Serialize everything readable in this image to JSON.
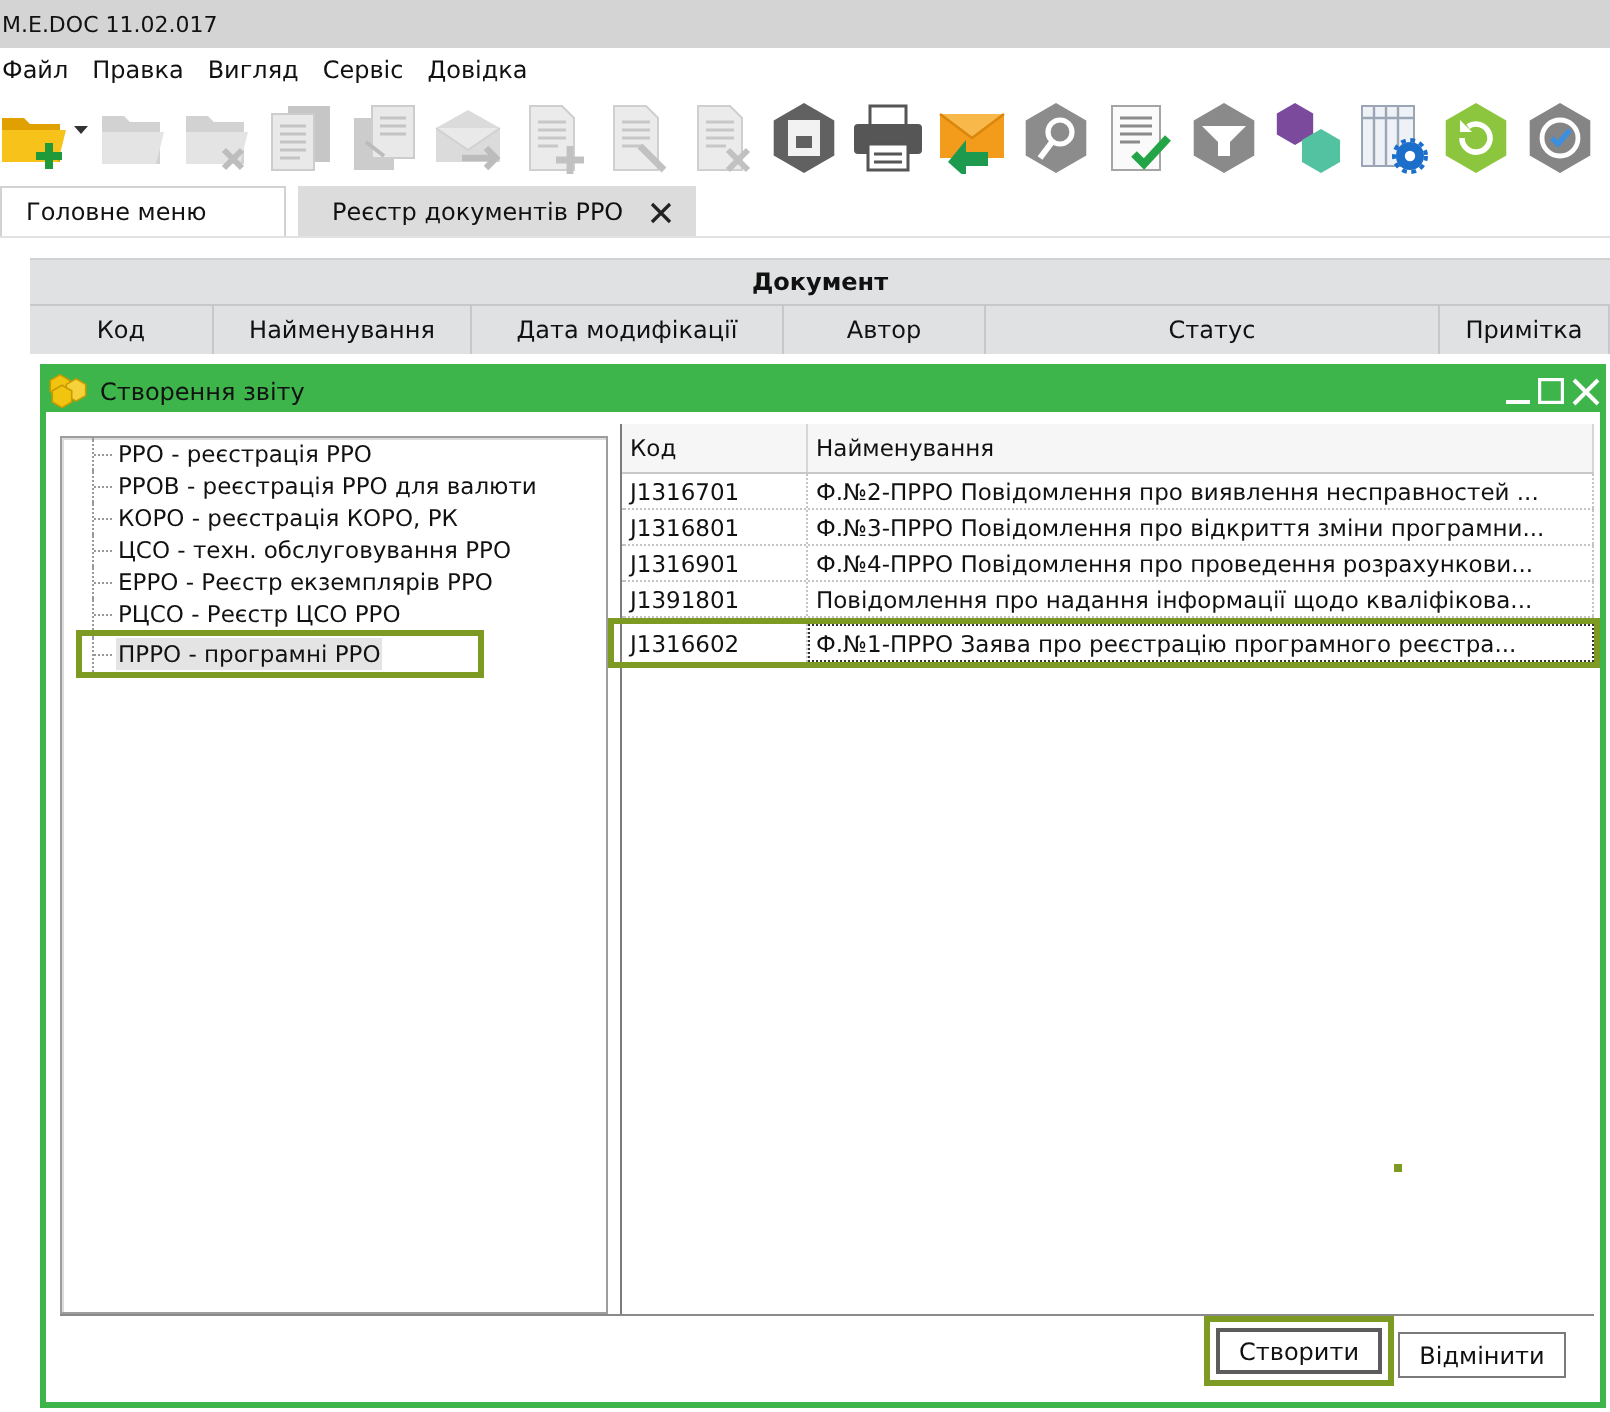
{
  "app": {
    "title": "M.E.DOC 11.02.017"
  },
  "menu": [
    "Файл",
    "Правка",
    "Вигляд",
    "Сервіс",
    "Довідка"
  ],
  "toolbar": [
    {
      "disabled": false
    },
    {
      "disabled": true
    },
    {
      "disabled": true
    },
    {
      "disabled": true
    },
    {
      "disabled": true
    },
    {
      "disabled": true
    },
    {
      "disabled": true
    },
    {
      "disabled": true
    },
    {
      "disabled": true
    },
    {
      "disabled": false
    },
    {
      "disabled": false
    },
    {
      "disabled": false
    },
    {
      "disabled": false
    },
    {
      "disabled": false
    },
    {
      "disabled": false
    },
    {
      "disabled": false
    },
    {
      "disabled": false
    },
    {
      "disabled": false
    },
    {
      "disabled": false
    }
  ],
  "tabs": [
    {
      "label": "Головне меню",
      "selected": false,
      "closable": false
    },
    {
      "label": "Реєстр документів РРО",
      "selected": true,
      "closable": true
    }
  ],
  "documents_table": {
    "group_header": "Документ",
    "columns": [
      "Код",
      "Найменування",
      "Дата модифікації",
      "Автор",
      "Статус",
      "Примітка"
    ]
  },
  "dialog": {
    "title": "Створення звіту",
    "tree": [
      {
        "label": "РРО - реєстрація РРО",
        "selected": false
      },
      {
        "label": "РРОВ - реєстрація РРО для валюти",
        "selected": false
      },
      {
        "label": "КОРО - реєстрація КОРО, РК",
        "selected": false
      },
      {
        "label": "ЦСО - техн. обслуговування РРО",
        "selected": false
      },
      {
        "label": "ЕРРО - Реєстр екземплярів РРО",
        "selected": false
      },
      {
        "label": "РЦСО - Реєстр ЦСО РРО",
        "selected": false
      },
      {
        "label": "ПРРО - програмні РРО",
        "selected": true
      }
    ],
    "table": {
      "columns": [
        "Код",
        "Найменування"
      ],
      "rows": [
        {
          "code": "J1316701",
          "name": "Ф.№2-ПРРО Повідомлення про виявлення несправностей ...",
          "selected": false
        },
        {
          "code": "J1316801",
          "name": "Ф.№3-ПРРО Повідомлення про відкриття зміни програмни...",
          "selected": false
        },
        {
          "code": "J1316901",
          "name": "Ф.№4-ПРРО Повідомлення про проведення розрахункови...",
          "selected": false
        },
        {
          "code": "J1391801",
          "name": "Повідомлення про надання інформації щодо кваліфікова...",
          "selected": false
        },
        {
          "code": "J1316602",
          "name": "Ф.№1-ПРРО Заява про реєстрацію програмного реєстра...",
          "selected": true
        }
      ]
    },
    "buttons": [
      {
        "label": "Створити",
        "highlighted": true
      },
      {
        "label": "Відмінити",
        "highlighted": false
      }
    ]
  }
}
